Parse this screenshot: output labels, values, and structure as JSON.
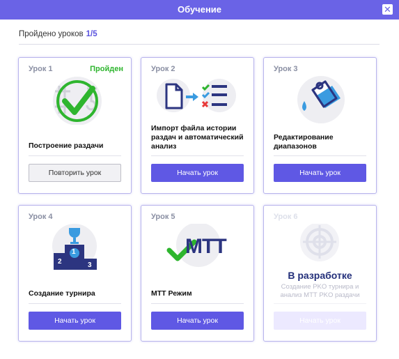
{
  "window": {
    "title": "Обучение"
  },
  "progress": {
    "label": "Пройдено уроков",
    "value": "1/5"
  },
  "lessons": [
    {
      "number": "Урок 1",
      "status": "Пройден",
      "title": "Построение раздачи",
      "button": "Повторить урок",
      "icon": "check-circle-icon"
    },
    {
      "number": "Урок 2",
      "title": "Импорт файла истории раздач и автоматический анализ",
      "button": "Начать урок",
      "icon": "file-import-icon"
    },
    {
      "number": "Урок 3",
      "title": "Редактирование диапазонов",
      "button": "Начать урок",
      "icon": "paint-bucket-icon"
    },
    {
      "number": "Урок 4",
      "title": "Создание турнира",
      "button": "Начать урок",
      "icon": "podium-trophy-icon",
      "podium": [
        "1",
        "2",
        "3"
      ]
    },
    {
      "number": "Урок 5",
      "title": "МТТ Режим",
      "button": "Начать урок",
      "icon": "mtt-check-icon",
      "logo": "МТТ"
    },
    {
      "number": "Урок 6",
      "title": "В разработке",
      "subtitle": "Создание PKO турнира и анализ МТТ PKO раздачи",
      "button": "Начать урок",
      "icon": "target-icon"
    }
  ],
  "colors": {
    "accent": "#5f58e4",
    "header": "#6a63e6",
    "success": "#2eb52e",
    "navy": "#232f7a"
  }
}
